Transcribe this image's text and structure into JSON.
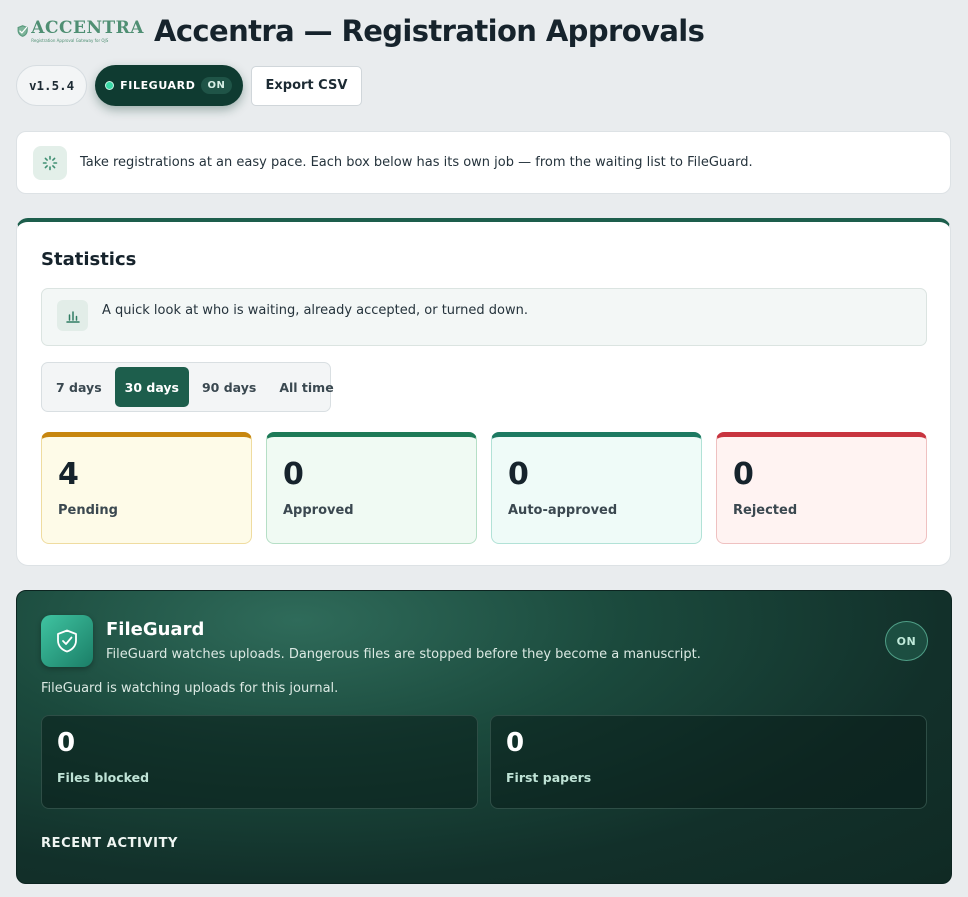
{
  "header": {
    "logo_word": "ACCENTRA",
    "logo_tagline": "Registration Approval Gateway for OJS",
    "title": "Accentra — Registration Approvals"
  },
  "toolbar": {
    "version": "v1.5.4",
    "fileguard_label": "FILEGUARD",
    "fileguard_state": "ON",
    "export_label": "Export CSV"
  },
  "intro": {
    "icon": "spinner-icon",
    "text": "Take registrations at an easy pace. Each box below has its own job — from the waiting list to FileGuard."
  },
  "statistics": {
    "title": "Statistics",
    "hint_icon": "bar-chart-icon",
    "hint": "A quick look at who is waiting, already accepted, or turned down.",
    "ranges": [
      {
        "label": "7 days",
        "active": false
      },
      {
        "label": "30 days",
        "active": true
      },
      {
        "label": "90 days",
        "active": false
      },
      {
        "label": "All time",
        "active": false
      }
    ],
    "cards": [
      {
        "value": "4",
        "label": "Pending",
        "accent": "#c7860e",
        "bg": "#fefbe8",
        "border": "#efdca0"
      },
      {
        "value": "0",
        "label": "Approved",
        "accent": "#1d7a57",
        "bg": "#f0faf3",
        "border": "#b6dfc6"
      },
      {
        "value": "0",
        "label": "Auto-approved",
        "accent": "#1d7a62",
        "bg": "#effbf8",
        "border": "#b2e2d7"
      },
      {
        "value": "0",
        "label": "Rejected",
        "accent": "#c8343f",
        "bg": "#fff3f2",
        "border": "#efc1c1"
      }
    ]
  },
  "fileguard": {
    "icon": "shield-check-icon",
    "title": "FileGuard",
    "description": "FileGuard watches uploads. Dangerous files are stopped before they become a manuscript.",
    "badge": "ON",
    "status": "FileGuard is watching uploads for this journal.",
    "metrics": [
      {
        "value": "0",
        "label": "Files blocked"
      },
      {
        "value": "0",
        "label": "First papers"
      }
    ],
    "recent_activity_heading": "RECENT ACTIVITY"
  },
  "colors": {
    "brand": "#1d5e4c",
    "page_bg": "#e9ecee"
  }
}
